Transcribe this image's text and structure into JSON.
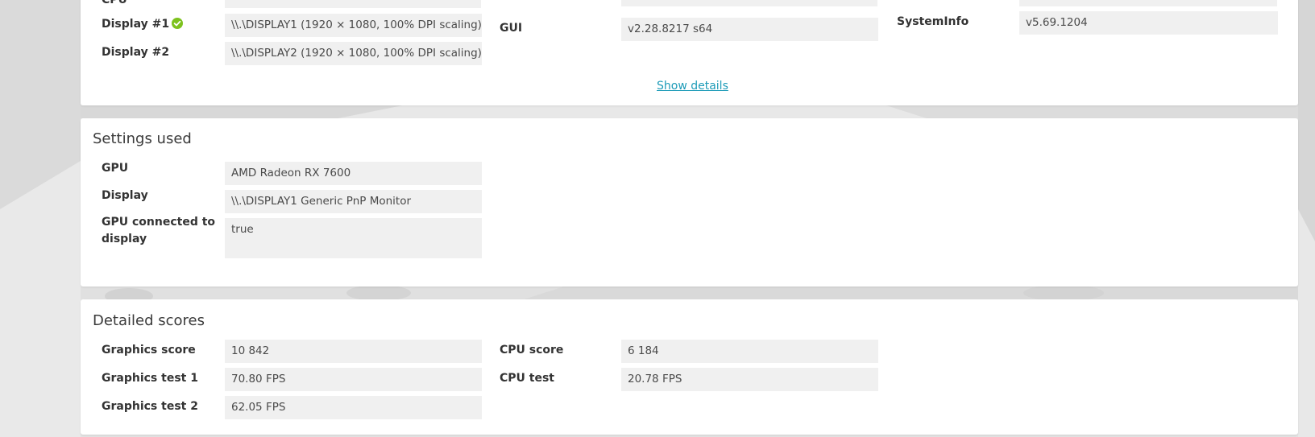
{
  "system": {
    "cpu_label_partial": "CPU",
    "display1": {
      "label": "Display #1",
      "value": "\\\\.\\DISPLAY1 (1920 × 1080, 100% DPI scaling)"
    },
    "display2": {
      "label": "Display #2",
      "value": "\\\\.\\DISPLAY2 (1920 × 1080, 100% DPI scaling)"
    },
    "gui": {
      "label": "GUI",
      "value": "v2.28.8217 s64"
    },
    "systeminfo": {
      "label": "SystemInfo",
      "value": "v5.69.1204"
    },
    "show_details": "Show details"
  },
  "settings": {
    "title": "Settings used",
    "gpu": {
      "label": "GPU",
      "value": "AMD Radeon RX 7600"
    },
    "display": {
      "label": "Display",
      "value": "\\\\.\\DISPLAY1 Generic PnP Monitor"
    },
    "gpu_connected": {
      "label": "GPU connected to display",
      "value": "true"
    }
  },
  "scores": {
    "title": "Detailed scores",
    "graphics_score": {
      "label": "Graphics score",
      "value": "10 842"
    },
    "graphics_test1": {
      "label": "Graphics test 1",
      "value": "70.80 FPS"
    },
    "graphics_test2": {
      "label": "Graphics test 2",
      "value": "62.05 FPS"
    },
    "cpu_score": {
      "label": "CPU score",
      "value": "6 184"
    },
    "cpu_test": {
      "label": "CPU test",
      "value": "20.78 FPS"
    }
  },
  "colors": {
    "accent_link": "#1d9bb8",
    "check_green": "#7dc21e",
    "panel_bg": "#ffffff",
    "value_bg": "#f0f0f0"
  },
  "icons": {
    "status_ok": "check-circle-icon"
  }
}
